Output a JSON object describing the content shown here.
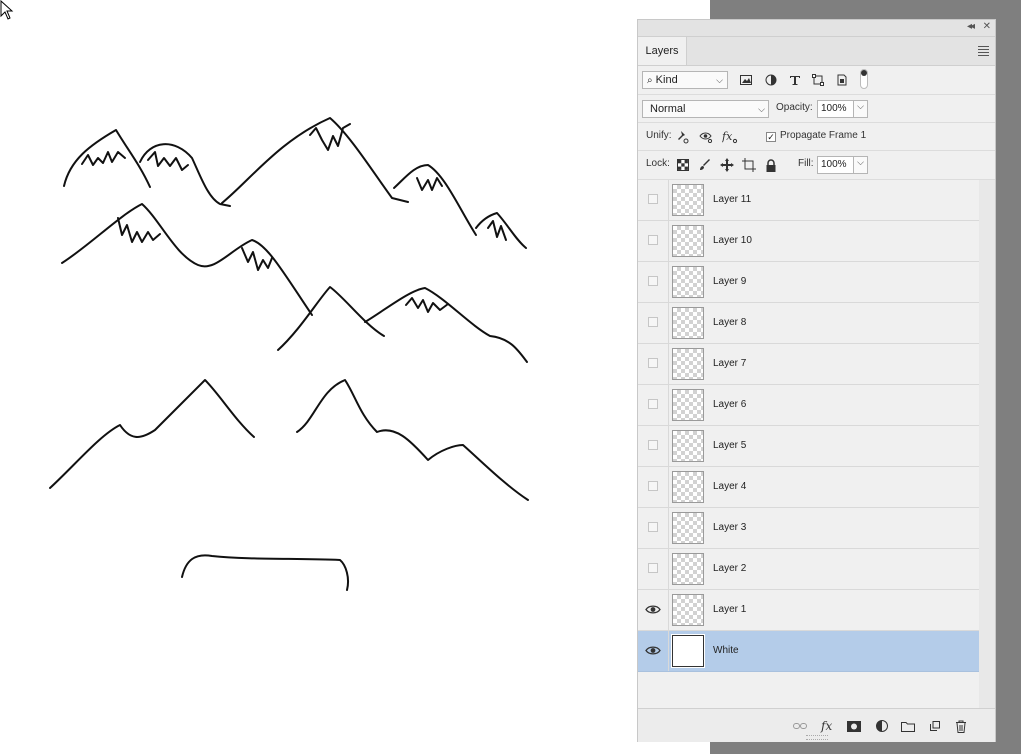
{
  "colors": {
    "canvas": "#ffffff",
    "pasteboard": "#7f7f7f",
    "panel": "#f0f0f0",
    "selection": "#b4cce9"
  },
  "icons": {
    "filter": [
      "image-filter-icon",
      "adjustment-filter-icon",
      "type-filter-icon",
      "shape-filter-icon",
      "smart-object-filter-icon"
    ],
    "unify": [
      "unify-position-icon",
      "unify-visibility-icon",
      "unify-style-icon"
    ],
    "lock": [
      "lock-transparent-pixels-icon",
      "lock-image-pixels-icon",
      "lock-position-icon",
      "lock-artboard-icon",
      "lock-all-icon"
    ],
    "footer": [
      "link-layers-icon",
      "add-layer-style-icon",
      "add-mask-icon",
      "new-fill-adjustment-icon",
      "new-group-icon",
      "new-layer-icon",
      "delete-layer-icon"
    ]
  },
  "panel": {
    "tab_label": "Layers",
    "filter": {
      "kind_label": "Kind"
    },
    "blend_mode": "Normal",
    "opacity_label": "Opacity:",
    "opacity_value": "100%",
    "unify_label": "Unify:",
    "propagate_label": "Propagate Frame 1",
    "propagate_checked": true,
    "lock_label": "Lock:",
    "fill_label": "Fill:",
    "fill_value": "100%",
    "layers": [
      {
        "name": "Layer 11",
        "visible": false,
        "selected": false
      },
      {
        "name": "Layer 10",
        "visible": false,
        "selected": false
      },
      {
        "name": "Layer 9",
        "visible": false,
        "selected": false
      },
      {
        "name": "Layer 8",
        "visible": false,
        "selected": false
      },
      {
        "name": "Layer 7",
        "visible": false,
        "selected": false
      },
      {
        "name": "Layer 6",
        "visible": false,
        "selected": false
      },
      {
        "name": "Layer 5",
        "visible": false,
        "selected": false
      },
      {
        "name": "Layer 4",
        "visible": false,
        "selected": false
      },
      {
        "name": "Layer 3",
        "visible": false,
        "selected": false
      },
      {
        "name": "Layer 2",
        "visible": false,
        "selected": false
      },
      {
        "name": "Layer 1",
        "visible": true,
        "selected": false
      },
      {
        "name": "White",
        "visible": true,
        "selected": true
      }
    ]
  }
}
